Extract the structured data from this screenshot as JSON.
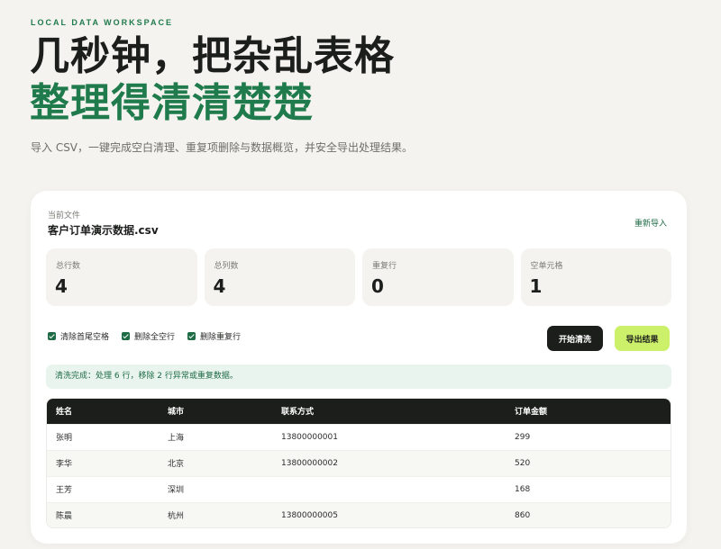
{
  "hero": {
    "eyebrow": "LOCAL DATA WORKSPACE",
    "line1": "几秒钟，把杂乱表格",
    "line2": "整理得清清楚楚",
    "subtitle": "导入 CSV，一键完成空白清理、重复项删除与数据概览，并安全导出处理结果。"
  },
  "file": {
    "label": "当前文件",
    "name": "客户订单演示数据.csv",
    "reimport_label": "重新导入"
  },
  "stats": [
    {
      "label": "总行数",
      "value": "4"
    },
    {
      "label": "总列数",
      "value": "4"
    },
    {
      "label": "重复行",
      "value": "0"
    },
    {
      "label": "空单元格",
      "value": "1"
    }
  ],
  "options": [
    {
      "label": "清除首尾空格",
      "checked": true
    },
    {
      "label": "删除全空行",
      "checked": true
    },
    {
      "label": "删除重复行",
      "checked": true
    }
  ],
  "actions": {
    "clean_label": "开始清洗",
    "export_label": "导出结果"
  },
  "status_message": "清洗完成：处理 6 行，移除 2 行异常或重复数据。",
  "table": {
    "columns": [
      "姓名",
      "城市",
      "联系方式",
      "订单金额"
    ],
    "rows": [
      [
        "张明",
        "上海",
        "13800000001",
        "299"
      ],
      [
        "李华",
        "北京",
        "13800000002",
        "520"
      ],
      [
        "王芳",
        "深圳",
        "",
        "168"
      ],
      [
        "陈晨",
        "杭州",
        "13800000005",
        "860"
      ]
    ]
  },
  "colors": {
    "accent_green": "#1f7a4c",
    "dark": "#1c1e1c",
    "lime": "#cdf06a",
    "background": "#f5f3ef"
  }
}
